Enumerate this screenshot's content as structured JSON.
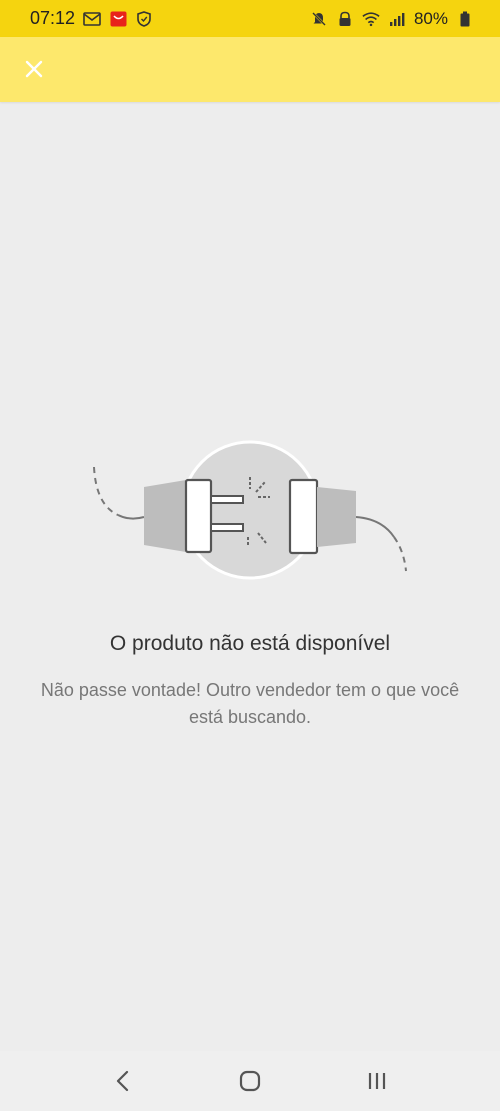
{
  "status_bar": {
    "time": "07:12",
    "battery": "80%",
    "left_icons": [
      "mail-icon",
      "app-notification-icon",
      "shield-icon"
    ],
    "right_icons": [
      "mute-icon",
      "lock-icon",
      "wifi-icon",
      "signal-icon",
      "battery-icon"
    ]
  },
  "colors": {
    "status_bar": "#f5d40f",
    "app_bar": "#fde86c",
    "background": "#ededed",
    "accent_red": "#e8231b"
  },
  "header": {
    "close_icon": "close-icon"
  },
  "empty_state": {
    "illustration": "unplugged-connector-icon",
    "title": "O produto não está disponível",
    "message": "Não passe vontade! Outro vendedor tem o que você está buscando."
  },
  "nav_bar": {
    "buttons": [
      "back-icon",
      "home-icon",
      "recent-apps-icon"
    ]
  }
}
